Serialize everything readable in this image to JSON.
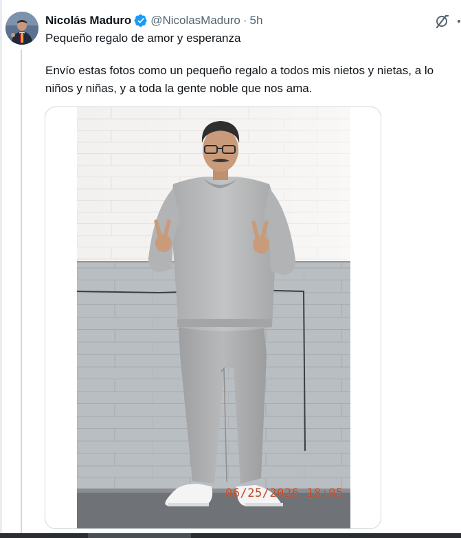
{
  "tweet": {
    "display_name": "Nicolás Maduro",
    "verified_icon": "verified-badge-icon",
    "handle": "@NicolasMaduro",
    "separator": "·",
    "time": "5h",
    "text_line1": "Pequeño regalo de amor y esperanza",
    "text_line2": "Envío estas fotos como un pequeño regalo a todos mis nietos y nietas, a lo",
    "text_line3": "niños y niñas, y a toda la gente noble que nos ama.",
    "photo_timestamp": "06/25/2026  18:05",
    "actions": {
      "grok_icon": "grok-icon",
      "more_icon": "more-options-icon"
    }
  },
  "colors": {
    "text_primary": "#0f1419",
    "text_secondary": "#536471",
    "verified_blue": "#1d9bf0",
    "border": "#cfd9de",
    "timestamp_red": "#c04a2a"
  }
}
